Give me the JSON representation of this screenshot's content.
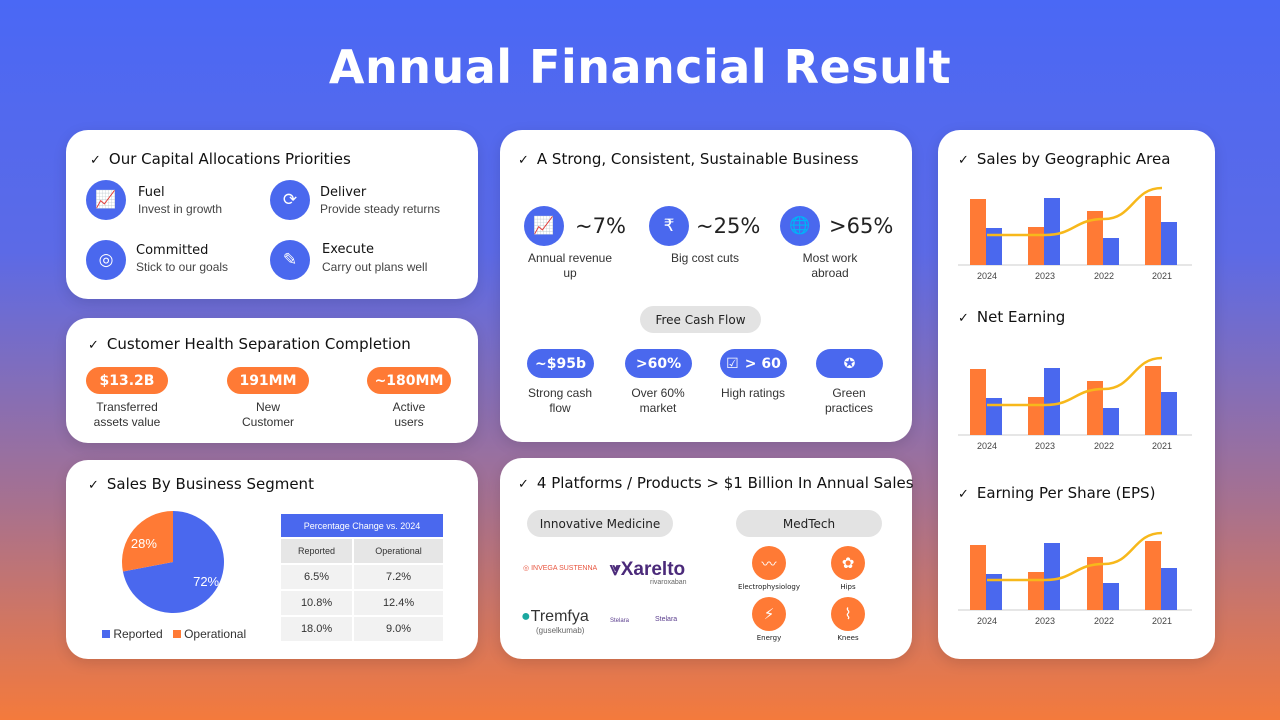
{
  "title": "Annual Financial Result",
  "capital": {
    "heading": "Our Capital Allocations Priorities",
    "items": [
      {
        "label": "Fuel",
        "sub": "Invest in growth",
        "icon": "growth-chart-icon"
      },
      {
        "label": "Deliver",
        "sub": "Provide steady returns",
        "icon": "cycle-icon"
      },
      {
        "label": "Committed",
        "sub": "Stick to our goals",
        "icon": "target-icon"
      },
      {
        "label": "Execute",
        "sub": "Carry out plans well",
        "icon": "notepad-icon"
      }
    ]
  },
  "customer": {
    "heading": "Customer Health Separation Completion",
    "items": [
      {
        "value": "$13.2B",
        "caption": "Transferred\nassets value"
      },
      {
        "value": "191MM",
        "caption": "New\nCustomer"
      },
      {
        "value": "~180MM",
        "caption": "Active\nusers"
      }
    ]
  },
  "segment": {
    "heading": "Sales By Business Segment",
    "table": {
      "title": "Percentage Change vs. 2024",
      "columns": [
        "Reported",
        "Operational"
      ],
      "rows": [
        [
          "6.5%",
          "7.2%"
        ],
        [
          "10.8%",
          "12.4%"
        ],
        [
          "18.0%",
          "9.0%"
        ]
      ]
    }
  },
  "business": {
    "heading": "A Strong, Consistent, Sustainable Business",
    "stats": [
      {
        "value": "~7%",
        "caption": "Annual revenue up",
        "icon": "revenue-up-icon"
      },
      {
        "value": "~25%",
        "caption": "Big cost cuts",
        "icon": "rupee-bars-icon"
      },
      {
        "value": ">65%",
        "caption": "Most work abroad",
        "icon": "globe-icon"
      }
    ],
    "fcf_label": "Free Cash Flow",
    "pills": [
      {
        "value": "~$95b",
        "caption": "Strong cash flow"
      },
      {
        "value": ">60%",
        "caption": "Over 60% market"
      },
      {
        "value": "> 60",
        "caption": "High ratings",
        "icon": "calendar-check-icon"
      },
      {
        "value": "",
        "caption": "Green practices",
        "icon": "badge-star-icon"
      }
    ]
  },
  "platforms": {
    "heading": "4 Platforms / Products > $1 Billion In Annual Sales",
    "innovative_label": "Innovative Medicine",
    "medtech_label": "MedTech",
    "logos": [
      "INVEGA SUSTENNA",
      "Xarelto",
      "rivaroxaban",
      "Tremfya",
      "(guselkumab)",
      "Stelara",
      "Stelara"
    ],
    "medtech": [
      {
        "label": "Electrophysiology",
        "icon": "heartbeat-icon"
      },
      {
        "label": "Hips",
        "icon": "hip-joint-icon"
      },
      {
        "label": "Energy",
        "icon": "lightning-icon"
      },
      {
        "label": "Knees",
        "icon": "knee-joint-icon"
      }
    ]
  },
  "colors": {
    "blue": "#4a68ee",
    "orange": "#ff7a35",
    "line": "#f7b81b"
  },
  "chart_data": [
    {
      "type": "pie",
      "title": "Sales By Business Segment",
      "slices": [
        {
          "name": "Reported",
          "value": 72,
          "label": "72%",
          "color": "#4a68ee"
        },
        {
          "name": "Operational",
          "value": 28,
          "label": "28%",
          "color": "#ff7a35"
        }
      ],
      "legend": "bottom"
    },
    {
      "type": "bar",
      "title": "Sales by Geographic Area",
      "categories": [
        "2024",
        "2023",
        "2022",
        "2021"
      ],
      "series": [
        {
          "values": [
            66,
            38,
            54,
            69
          ],
          "color": "#ff7a35"
        },
        {
          "values": [
            37,
            67,
            27,
            43
          ],
          "color": "#4a68ee"
        },
        {
          "type": "line",
          "values": [
            30,
            30,
            46,
            77
          ],
          "color": "#f7b81b"
        }
      ],
      "ylim": [
        0,
        85
      ],
      "grid": false
    },
    {
      "type": "bar",
      "title": "Net Earning",
      "categories": [
        "2024",
        "2023",
        "2022",
        "2021"
      ],
      "series": [
        {
          "values": [
            66,
            38,
            54,
            69
          ],
          "color": "#ff7a35"
        },
        {
          "values": [
            37,
            67,
            27,
            43
          ],
          "color": "#4a68ee"
        },
        {
          "type": "line",
          "values": [
            30,
            30,
            46,
            77
          ],
          "color": "#f7b81b"
        }
      ],
      "ylim": [
        0,
        85
      ],
      "grid": false
    },
    {
      "type": "bar",
      "title": "Earning Per Share (EPS)",
      "categories": [
        "2024",
        "2023",
        "2022",
        "2021"
      ],
      "series": [
        {
          "values": [
            65,
            38,
            53,
            69
          ],
          "color": "#ff7a35"
        },
        {
          "values": [
            36,
            67,
            27,
            42
          ],
          "color": "#4a68ee"
        },
        {
          "type": "line",
          "values": [
            30,
            30,
            46,
            77
          ],
          "color": "#f7b81b"
        }
      ],
      "ylim": [
        0,
        85
      ],
      "grid": false
    }
  ]
}
